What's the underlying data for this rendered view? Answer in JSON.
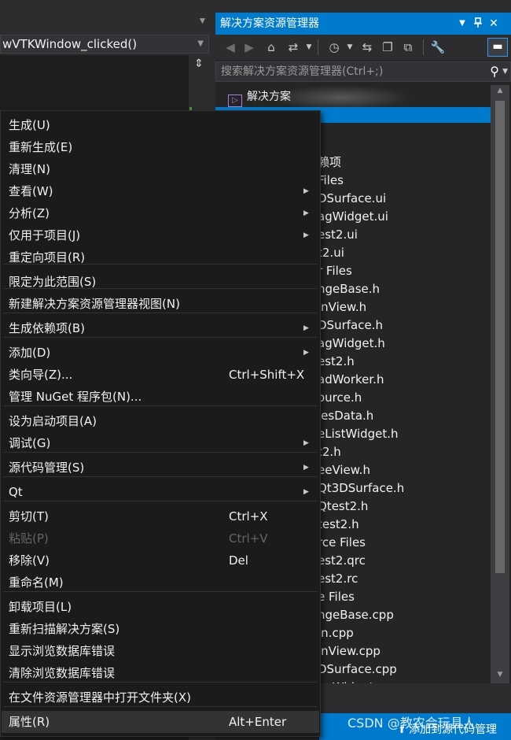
{
  "editor": {
    "function_combo": "wVTKWindow_clicked()"
  },
  "solution_explorer": {
    "title": "解决方案资源管理器",
    "title_buttons": [
      "▼",
      "⊥",
      "✕"
    ],
    "search_placeholder": "搜索解决方案资源管理器(Ctrl+;)",
    "solution_label": "解决方案",
    "tree_items": [
      "赖项",
      "Files",
      "DSurface.ui",
      "agWidget.ui",
      "est2.ui",
      "t2.ui",
      "r Files",
      "ngeBase.h",
      "inView.h",
      "DSurface.h",
      "agWidget.h",
      "est2.h",
      "adWorker.h",
      "ource.h",
      "iesData.h",
      "eListWidget.h",
      "t2.h",
      "eeView.h",
      "Qt3DSurface.h",
      "Qtest2.h",
      "test2.h",
      "rce Files",
      "est2.qrc",
      "est2.rc",
      "e Files",
      "ngeBase.cpp",
      "in.cpp",
      "inView.cpp",
      "DSurface.cpp",
      "agWidget.cpp"
    ]
  },
  "context_menu": {
    "items": [
      {
        "label": "生成(U)"
      },
      {
        "label": "重新生成(E)"
      },
      {
        "label": "清理(N)"
      },
      {
        "label": "查看(W)",
        "submenu": true
      },
      {
        "label": "分析(Z)",
        "submenu": true
      },
      {
        "label": "仅用于项目(J)",
        "submenu": true
      },
      {
        "label": "重定向项目(R)"
      },
      {
        "label": "限定为此范围(S)"
      },
      {
        "label": "新建解决方案资源管理器视图(N)"
      },
      {
        "label": "生成依赖项(B)",
        "submenu": true
      },
      {
        "label": "添加(D)",
        "submenu": true
      },
      {
        "label": "类向导(Z)...",
        "shortcut": "Ctrl+Shift+X"
      },
      {
        "label": "管理 NuGet 程序包(N)..."
      },
      {
        "label": "设为启动项目(A)"
      },
      {
        "label": "调试(G)",
        "submenu": true
      },
      {
        "label": "源代码管理(S)",
        "submenu": true
      },
      {
        "label": "Qt",
        "submenu": true
      },
      {
        "label": "剪切(T)",
        "shortcut": "Ctrl+X"
      },
      {
        "label": "粘贴(P)",
        "shortcut": "Ctrl+V",
        "disabled": true
      },
      {
        "label": "移除(V)",
        "shortcut": "Del"
      },
      {
        "label": "重命名(M)"
      },
      {
        "label": "卸载项目(L)"
      },
      {
        "label": "重新扫描解决方案(S)"
      },
      {
        "label": "显示浏览数据库错误"
      },
      {
        "label": "清除浏览数据库错误"
      },
      {
        "label": "在文件资源管理器中打开文件夹(X)"
      },
      {
        "label": "属性(R)",
        "shortcut": "Alt+Enter"
      }
    ]
  },
  "status_bar": {
    "text": "添加到源代码管理",
    "watermark": "CSDN @教农会玩具人"
  },
  "colors": {
    "accent": "#007acc",
    "menu_bg": "#1b1b1c",
    "panel_bg": "#252526",
    "chrome_bg": "#2d2d30"
  }
}
